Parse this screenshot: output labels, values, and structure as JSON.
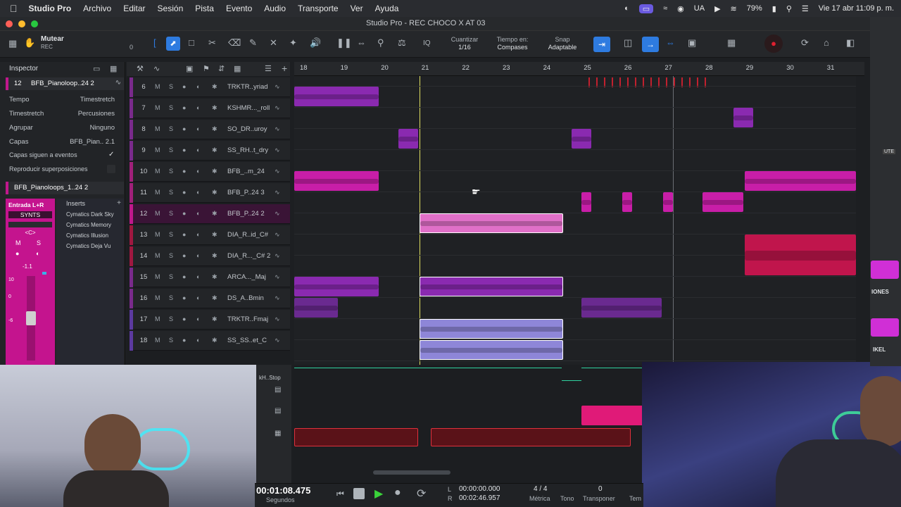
{
  "menubar": {
    "app": "Studio Pro",
    "items": [
      "Archivo",
      "Editar",
      "Sesión",
      "Pista",
      "Evento",
      "Audio",
      "Transporte",
      "Ver",
      "Ayuda"
    ],
    "battery": "79%",
    "lang": "UA",
    "datetime": "Vie 17 abr  11:09 p. m."
  },
  "window": {
    "title": "Studio Pro - REC CHOCO X AT 03"
  },
  "toolbar": {
    "mute_label": "Mutear",
    "rec_label": "REC",
    "zero": "0",
    "quantize_label": "Cuantizar",
    "quantize_value": "1/16",
    "timebase_label": "Tiempo en:",
    "timebase_value": "Compases",
    "snap_label": "Snap",
    "snap_value": "Adaptable",
    "iq": "IQ"
  },
  "inspector": {
    "title": "Inspector",
    "track_num": "12",
    "track_name": "BFB_Pianoloop..24 2",
    "rows": [
      {
        "label": "Tempo",
        "value": "Timestretch"
      },
      {
        "label": "Timestretch",
        "value": "Percusiones"
      },
      {
        "label": "Agrupar",
        "value": "Ninguno"
      },
      {
        "label": "Capas",
        "value": "BFB_Pian.. 2.1"
      }
    ],
    "follow": "Capas siguen a eventos",
    "overlap": "Reproducir superposiciones",
    "clip_name": "BFB_Pianoloops_1..24 2",
    "input": "Entrada L+R",
    "synts": "SYNTS",
    "lr": "<C>",
    "m": "M",
    "s": "S",
    "gain": "-1.1",
    "inserts": "Inserts",
    "plugins": [
      "Cymatics Dark Sky",
      "Cymatics Memory",
      "Cymatics Illusion",
      "Cymatics Deja Vu"
    ],
    "scale": [
      "10",
      "0",
      "-6"
    ]
  },
  "tracks": [
    {
      "num": "6",
      "name": "TRKTR..yriad",
      "color": "#7a2a8c"
    },
    {
      "num": "7",
      "name": "KSHMR..._roll",
      "color": "#7a2a8c"
    },
    {
      "num": "8",
      "name": "SO_DR..uroy",
      "color": "#7a2a8c"
    },
    {
      "num": "9",
      "name": "SS_RH..t_dry",
      "color": "#7a2a8c"
    },
    {
      "num": "10",
      "name": "BFB_..m_24",
      "color": "#a0207a"
    },
    {
      "num": "11",
      "name": "BFB_P..24 3",
      "color": "#a0207a"
    },
    {
      "num": "12",
      "name": "BFB_P..24 2",
      "color": "#c0188c"
    },
    {
      "num": "13",
      "name": "DIA_R..id_C#",
      "color": "#a01840"
    },
    {
      "num": "14",
      "name": "DIA_R..._C# 2",
      "color": "#a01840"
    },
    {
      "num": "15",
      "name": "ARCA..._Maj",
      "color": "#7a2a8c"
    },
    {
      "num": "16",
      "name": "DS_A..Bmin",
      "color": "#7a2a8c"
    },
    {
      "num": "17",
      "name": "TRKTR..Fmaj",
      "color": "#5c3aa0"
    },
    {
      "num": "18",
      "name": "SS_SS..et_C",
      "color": "#5c3aa0"
    }
  ],
  "track_buttons": {
    "m": "M",
    "s": "S"
  },
  "ruler": [
    "18",
    "19",
    "20",
    "21",
    "22",
    "23",
    "24",
    "25",
    "26",
    "27",
    "28",
    "29",
    "30",
    "31"
  ],
  "lower": {
    "label": "kH..Stop"
  },
  "transport": {
    "time": "00:01:08.475",
    "time_unit": "Segundos",
    "loop_start": "00:00:00.000",
    "loop_end": "00:02:46.957",
    "l": "L",
    "r": "R",
    "signature": "4 / 4",
    "signature_label": "Métrica",
    "key_label": "Tono",
    "transpose": "0",
    "transpose_label": "Transponer",
    "tempo_label": "Tem"
  },
  "rightstrip": {
    "a": "IONES",
    "b": "IKEL",
    "c": "UTE"
  },
  "colors": {
    "accent": "#2e7be0",
    "magenta": "#c81ea8",
    "purple": "#8a2ab0",
    "crimson": "#c0154c",
    "lavender": "#8e86d8",
    "red": "#d62a36"
  }
}
